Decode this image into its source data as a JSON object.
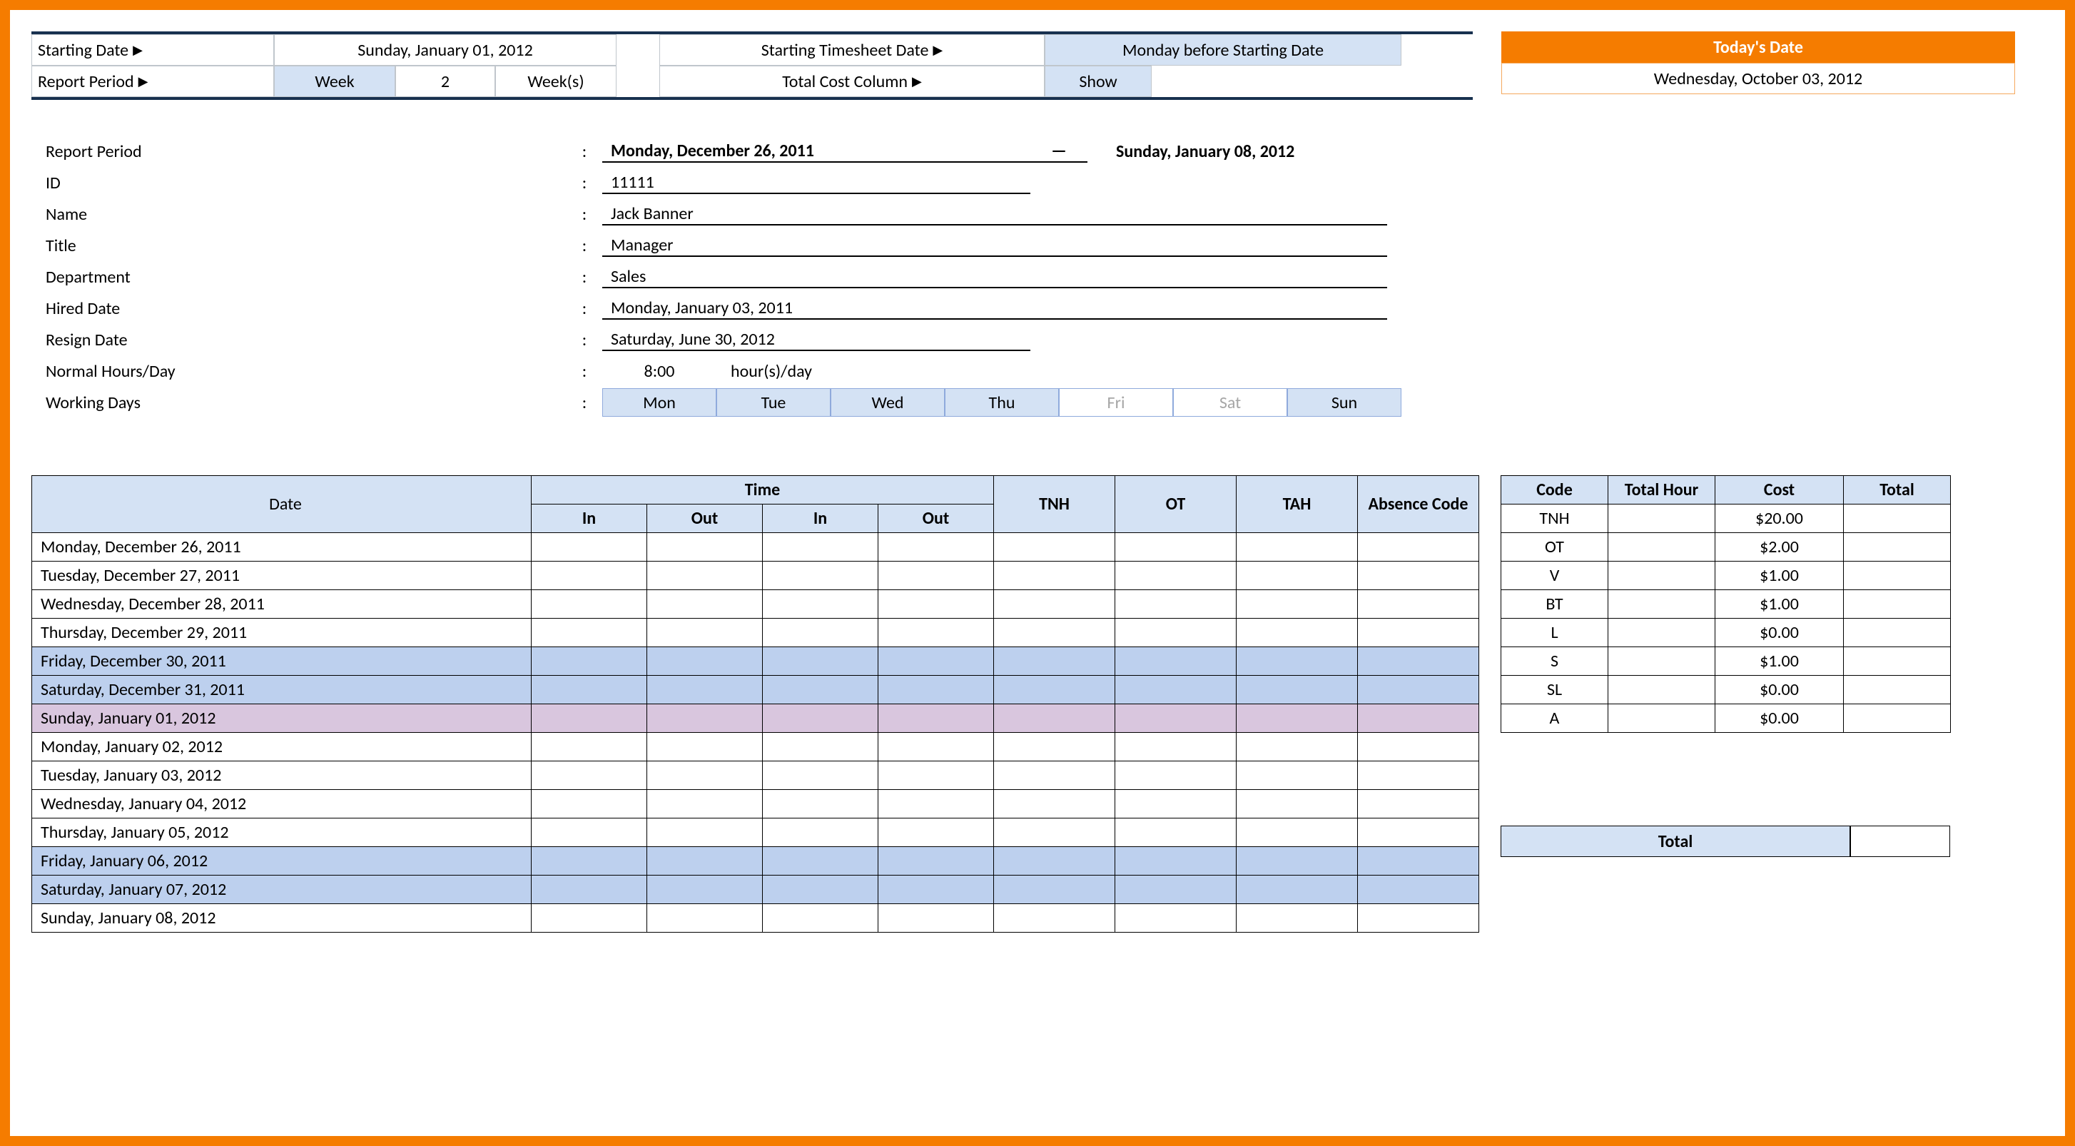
{
  "config": {
    "row1": {
      "label": "Starting Date",
      "value": "Sunday, January 01, 2012",
      "label2": "Starting Timesheet Date",
      "value2": "Monday before Starting Date"
    },
    "row2": {
      "label": "Report Period",
      "unit1": "Week",
      "count": "2",
      "unit2": "Week(s)",
      "label2": "Total Cost Column",
      "value2": "Show"
    },
    "today": {
      "header": "Today's Date",
      "value": "Wednesday, October 03, 2012"
    }
  },
  "info": {
    "period_label": "Report Period",
    "period_start": "Monday, December 26, 2011",
    "period_end": "Sunday, January 08, 2012",
    "id_label": "ID",
    "id": "11111",
    "name_label": "Name",
    "name": "Jack Banner",
    "title_label": "Title",
    "title": "Manager",
    "dept_label": "Department",
    "dept": "Sales",
    "hired_label": "Hired Date",
    "hired": "Monday, January 03, 2011",
    "resign_label": "Resign Date",
    "resign": "Saturday, June 30, 2012",
    "nhd_label": "Normal Hours/Day",
    "nhd": "8:00",
    "nhd_unit": "hour(s)/day",
    "wd_label": "Working Days",
    "days": [
      "Mon",
      "Tue",
      "Wed",
      "Thu",
      "Fri",
      "Sat",
      "Sun"
    ]
  },
  "table": {
    "headers": {
      "date": "Date",
      "time": "Time",
      "in": "In",
      "out": "Out",
      "tnh": "TNH",
      "ot": "OT",
      "tah": "TAH",
      "abs": "Absence Code"
    },
    "rows": [
      {
        "date": "Monday, December 26, 2011",
        "cls": ""
      },
      {
        "date": "Tuesday, December 27, 2011",
        "cls": ""
      },
      {
        "date": "Wednesday, December 28, 2011",
        "cls": ""
      },
      {
        "date": "Thursday, December 29, 2011",
        "cls": ""
      },
      {
        "date": "Friday, December 30, 2011",
        "cls": "row-blue"
      },
      {
        "date": "Saturday, December 31, 2011",
        "cls": "row-blue"
      },
      {
        "date": "Sunday, January 01, 2012",
        "cls": "row-pink"
      },
      {
        "date": "Monday, January 02, 2012",
        "cls": ""
      },
      {
        "date": "Tuesday, January 03, 2012",
        "cls": ""
      },
      {
        "date": "Wednesday, January 04, 2012",
        "cls": ""
      },
      {
        "date": "Thursday, January 05, 2012",
        "cls": ""
      },
      {
        "date": "Friday, January 06, 2012",
        "cls": "row-blue"
      },
      {
        "date": "Saturday, January 07, 2012",
        "cls": "row-blue"
      },
      {
        "date": "Sunday, January 08, 2012",
        "cls": ""
      }
    ]
  },
  "summary": {
    "headers": {
      "code": "Code",
      "hour": "Total Hour",
      "cost": "Cost",
      "total": "Total"
    },
    "rows": [
      {
        "code": "TNH",
        "cost": "$20.00"
      },
      {
        "code": "OT",
        "cost": "$2.00"
      },
      {
        "code": "V",
        "cost": "$1.00"
      },
      {
        "code": "BT",
        "cost": "$1.00"
      },
      {
        "code": "L",
        "cost": "$0.00"
      },
      {
        "code": "S",
        "cost": "$1.00"
      },
      {
        "code": "SL",
        "cost": "$0.00"
      },
      {
        "code": "A",
        "cost": "$0.00"
      }
    ],
    "total_label": "Total"
  }
}
